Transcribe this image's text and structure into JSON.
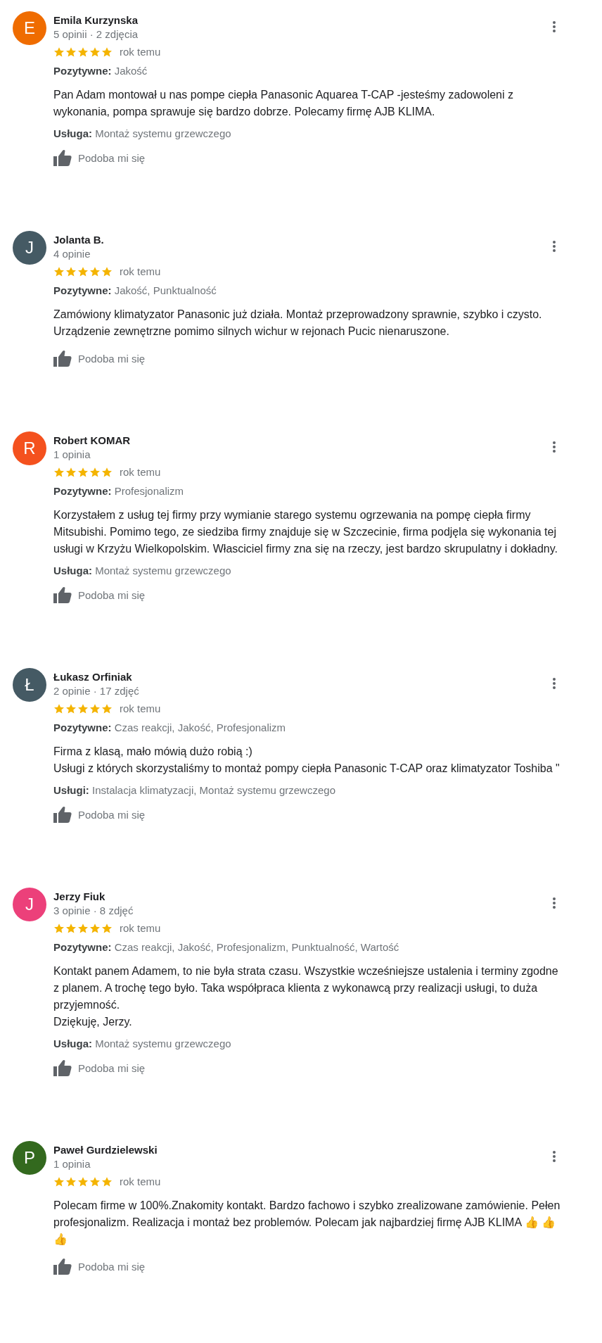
{
  "reviews": [
    {
      "avatar": {
        "letter": "E",
        "color": "#ef6c00"
      },
      "name": "Emila Kurzynska",
      "meta": "5 opinii · 2 zdjęcia",
      "stars": 5,
      "time": "rok temu",
      "positives": {
        "label": "Pozytywne:",
        "value": "Jakość"
      },
      "text": "Pan Adam montował u nas pompe ciepła Panasonic Aquarea T-CAP  -jesteśmy zadowoleni z wykonania, pompa sprawuje się bardzo dobrze. Polecamy firmę AJB KLIMA.",
      "service": {
        "label": "Usługa:",
        "value": "Montaż systemu grzewczego"
      },
      "like": "Podoba mi się"
    },
    {
      "avatar": {
        "letter": "J",
        "color": "#455a64"
      },
      "name": "Jolanta B.",
      "meta": "4 opinie",
      "stars": 5,
      "time": "rok temu",
      "positives": {
        "label": "Pozytywne:",
        "value": "Jakość, Punktualność"
      },
      "text": "Zamówiony klimatyzator Panasonic już działa. Montaż przeprowadzony sprawnie, szybko i czysto. Urządzenie zewnętrzne pomimo silnych wichur w rejonach Pucic nienaruszone.",
      "like": "Podoba mi się"
    },
    {
      "avatar": {
        "letter": "R",
        "color": "#f4511e"
      },
      "name": "Robert KOMAR",
      "meta": "1 opinia",
      "stars": 5,
      "time": "rok temu",
      "positives": {
        "label": "Pozytywne:",
        "value": "Profesjonalizm"
      },
      "text": "Korzystałem z usług tej firmy przy wymianie starego systemu ogrzewania na pompę ciepła firmy Mitsubishi. Pomimo tego, ze siedziba firmy znajduje się w Szczecinie, firma podjęla się wykonania tej usługi w Krzyżu Wielkopolskim. Własciciel firmy zna się na rzeczy, jest bardzo skrupulatny i dokładny.",
      "service": {
        "label": "Usługa:",
        "value": "Montaż systemu grzewczego"
      },
      "like": "Podoba mi się"
    },
    {
      "avatar": {
        "letter": "Ł",
        "color": "#455a64"
      },
      "name": "Łukasz Orfiniak",
      "meta": "2 opinie · 17 zdjęć",
      "stars": 5,
      "time": "rok temu",
      "positives": {
        "label": "Pozytywne:",
        "value": "Czas reakcji, Jakość, Profesjonalizm"
      },
      "text": "Firma z klasą, mało mówią dużo robią :)\nUsługi z których skorzystaliśmy to montaż pompy ciepła Panasonic T-CAP  oraz klimatyzator Toshiba \"",
      "service": {
        "label": "Usługi:",
        "value": "Instalacja klimatyzacji, Montaż systemu grzewczego"
      },
      "like": "Podoba mi się"
    },
    {
      "avatar": {
        "letter": "J",
        "color": "#ec407a"
      },
      "name": "Jerzy Fiuk",
      "meta": "3 opinie · 8 zdjęć",
      "stars": 5,
      "time": "rok temu",
      "positives": {
        "label": "Pozytywne:",
        "value": "Czas reakcji, Jakość, Profesjonalizm, Punktualność, Wartość"
      },
      "text": "Kontakt  panem Adamem, to nie była strata czasu. Wszystkie wcześniejsze ustalenia i terminy zgodne z planem. A trochę tego było. Taka współpraca klienta z wykonawcą przy realizacji usługi, to duża przyjemność.\nDziękuję, Jerzy.",
      "service": {
        "label": "Usługa:",
        "value": "Montaż systemu grzewczego"
      },
      "like": "Podoba mi się"
    },
    {
      "avatar": {
        "letter": "P",
        "color": "#33691e"
      },
      "name": "Paweł Gurdzielewski",
      "meta": "1 opinia",
      "stars": 5,
      "time": "rok temu",
      "text": "Polecam firme w 100%.Znakomity kontakt. Bardzo fachowo i szybko zrealizowane zamówienie. Pełen profesjonalizm. Realizacja  i montaż bez problemów. Polecam jak najbardziej firmę AJB KLIMA 👍 👍 👍",
      "like": "Podoba mi się"
    }
  ]
}
